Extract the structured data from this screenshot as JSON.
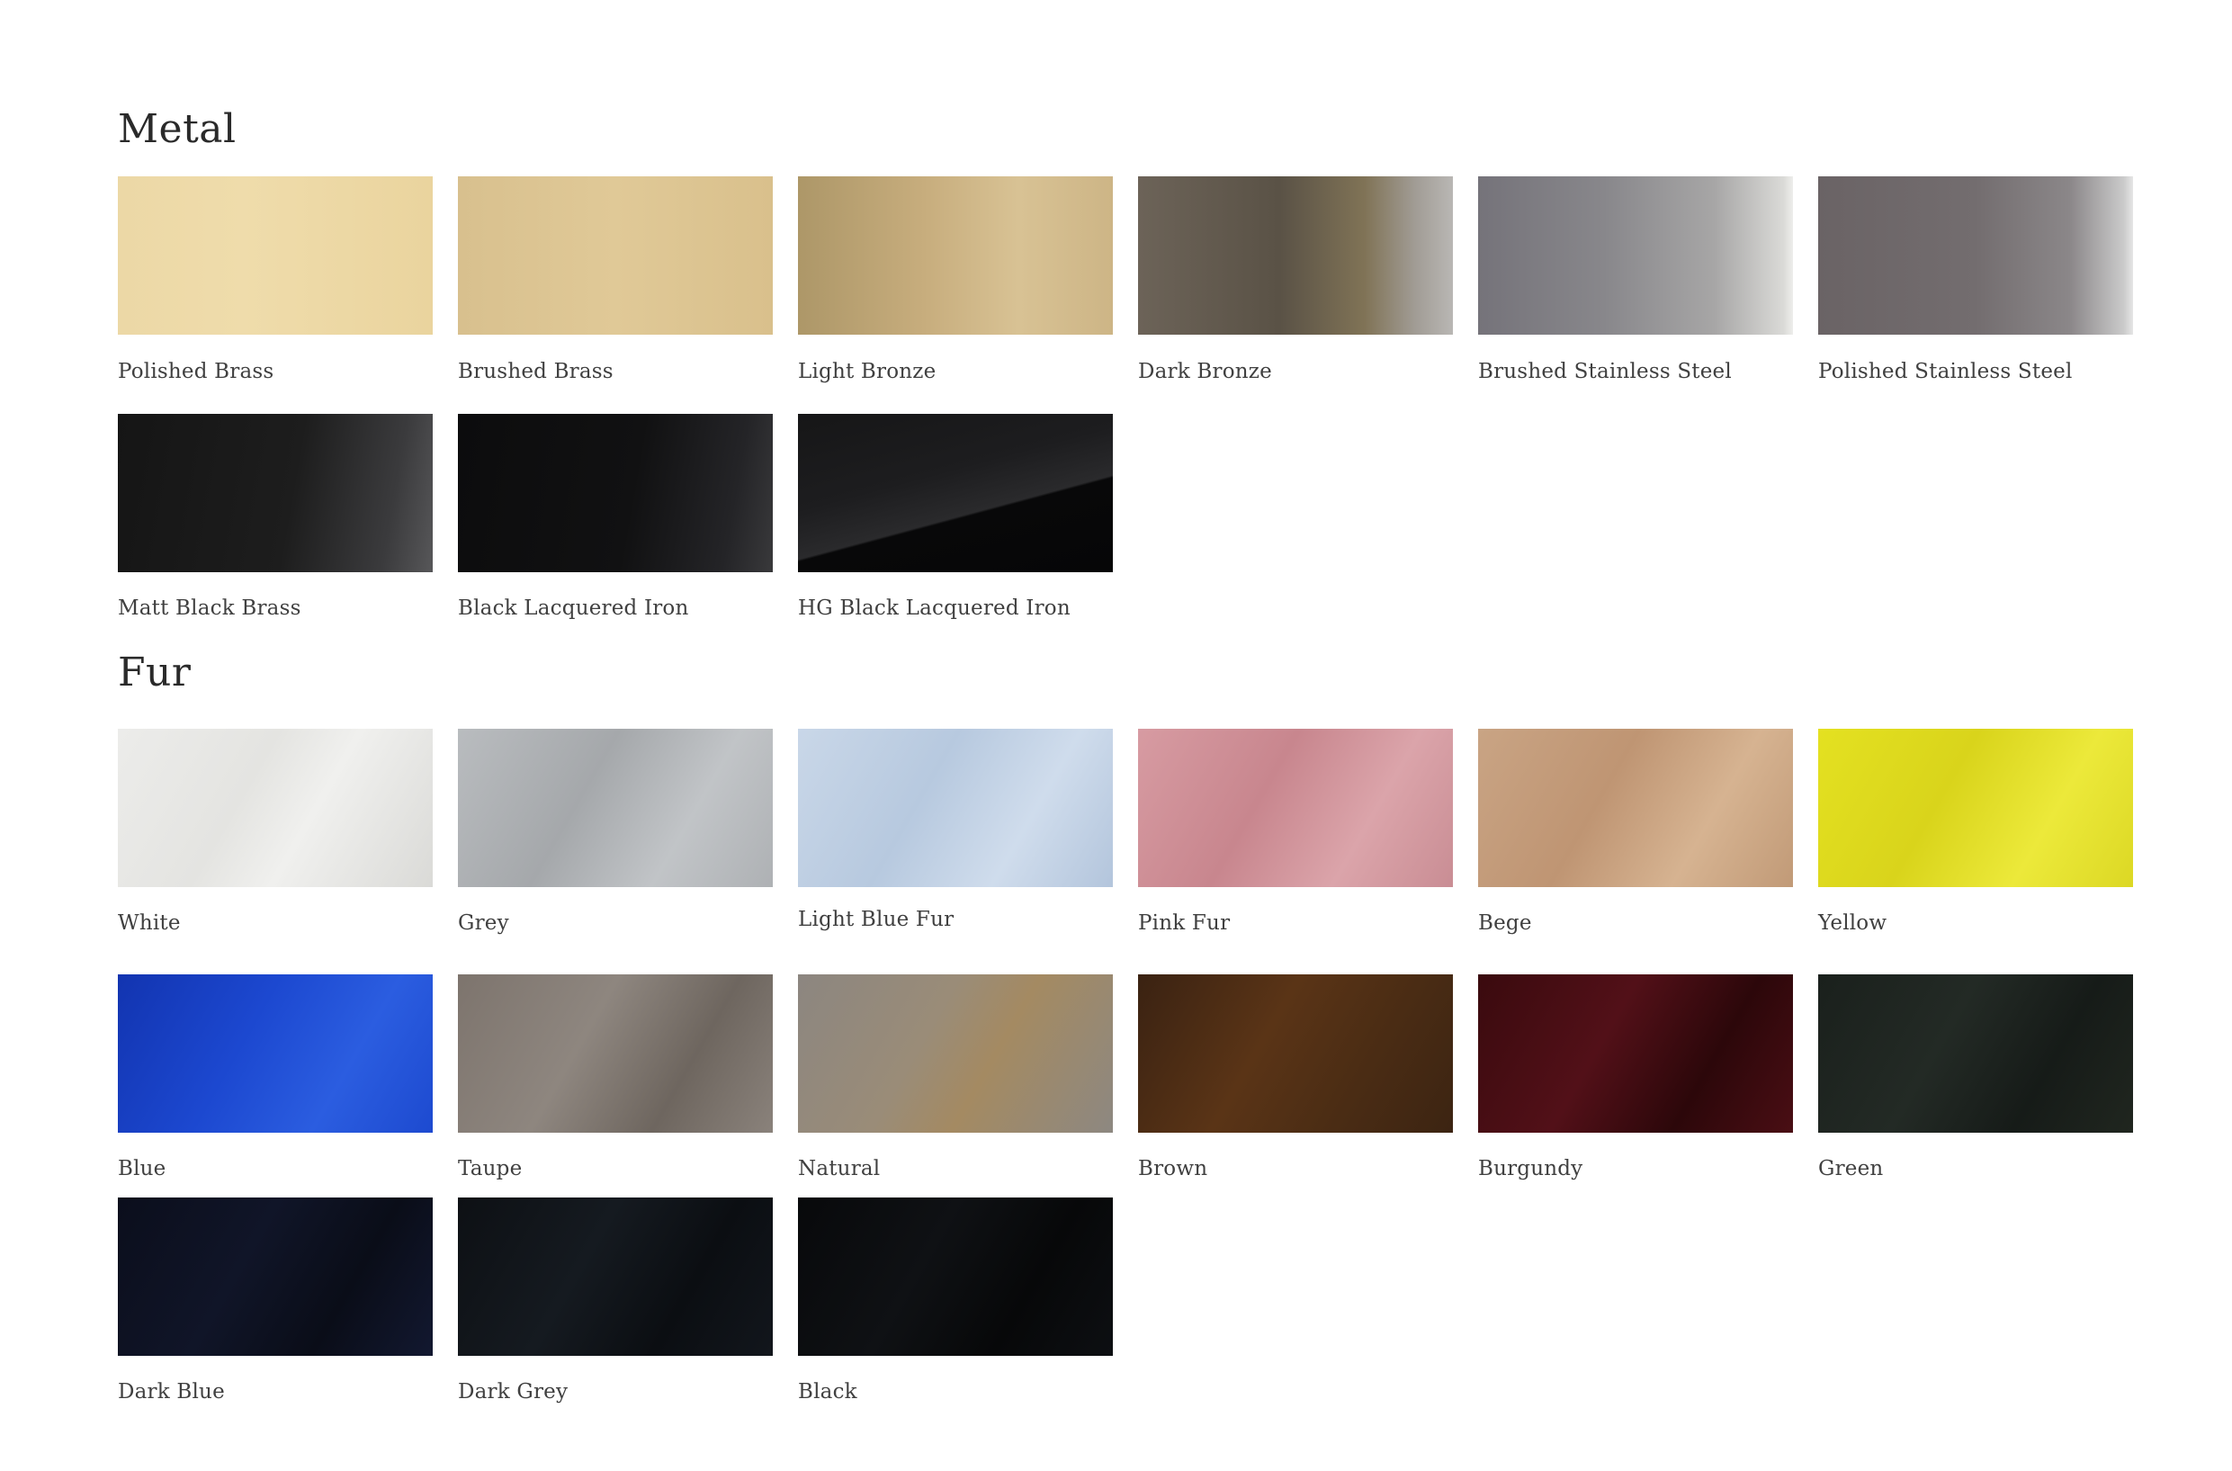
{
  "sections": [
    {
      "title": "Metal",
      "items": [
        {
          "label": "Polished Brass",
          "swatch": "linear-gradient(90deg,#ecd8a6 0%,#efdcab 40%,#ead49e 100%)"
        },
        {
          "label": "Brushed Brass",
          "swatch": "linear-gradient(90deg,#d8c08e 0%,#e0c997 50%,#d9c08c 100%)"
        },
        {
          "label": "Light Bronze",
          "swatch": "linear-gradient(90deg,#ad9768 0%,#c7ad7d 40%,#d8c294 70%,#cdb586 100%)"
        },
        {
          "label": "Dark Bronze",
          "swatch": "linear-gradient(90deg,#6c6358 0%,#5a5246 45%,#807356 72%,#a19c95 88%,#b9b7b4 100%)"
        },
        {
          "label": "Brushed Stainless Steel",
          "swatch": "linear-gradient(90deg,#75737a 0%,#88878b 40%,#a7a6a6 75%,#dadad7 97%,#eeeeec 100%)"
        },
        {
          "label": "Polished Stainless Steel",
          "swatch": "linear-gradient(90deg,#6a6365 0%,#736d6f 50%,#8b8789 80%,#cacaca 97%,#e6e6e6 100%)"
        }
      ]
    },
    {
      "title": "",
      "items": [
        {
          "label": "Matt Black Brass",
          "swatch": "linear-gradient(100deg,#151515 0%,#1d1d1d 55%,#3b3b3d 85%,#575759 100%)"
        },
        {
          "label": "Black Lacquered Iron",
          "swatch": "linear-gradient(100deg,#0c0c0d 0%,#111112 55%,#242427 85%,#39393b 100%)"
        },
        {
          "label": "HG Black Lacquered Iron",
          "swatch": "linear-gradient(165deg,#161617 0%,#1d1d1f 40%,#2a2a2c 60%,#080809 61%,#060607 100%)"
        }
      ]
    },
    {
      "title": "Fur",
      "items": [
        {
          "label": "White",
          "swatch": "linear-gradient(120deg,#ececea 0%,#e4e4e1 40%,#f0f0ee 60%,#dadad7 100%)"
        },
        {
          "label": "Grey",
          "swatch": "linear-gradient(120deg,#b9bcbf 0%,#a5a8ab 40%,#c1c4c7 70%,#aeb1b4 100%)"
        },
        {
          "label": "Light Blue Fur",
          "swatch": "linear-gradient(120deg,#c9d7e8 0%,#b7c9df 40%,#cfdcec 70%,#b3c5dc 100%)"
        },
        {
          "label": "Pink Fur",
          "swatch": "linear-gradient(120deg,#d79ba2 0%,#c8868e 40%,#dba4aa 70%,#c98d94 100%)"
        },
        {
          "label": "Bege",
          "swatch": "linear-gradient(120deg,#c9a484 0%,#bf9573 40%,#d6b391 70%,#c19a77 100%)"
        },
        {
          "label": "Yellow",
          "swatch": "linear-gradient(120deg,#e4e121 0%,#d9d41b 40%,#ece93a 70%,#dcd824 100%)"
        }
      ]
    },
    {
      "title": "",
      "items": [
        {
          "label": "Blue",
          "swatch": "linear-gradient(120deg,#1234b0 0%,#1c48d0 40%,#2b5de0 70%,#1d4ad0 100%)"
        },
        {
          "label": "Taupe",
          "swatch": "linear-gradient(120deg,#7d746d 0%,#8e867f 40%,#6e665f 70%,#8a827b 100%)"
        },
        {
          "label": "Natural",
          "swatch": "linear-gradient(120deg,#8c8680 0%,#9a8c78 40%,#a48a62 60%,#8d8881 100%)"
        },
        {
          "label": "Brown",
          "swatch": "linear-gradient(120deg,#3a2212 0%,#5a3416 40%,#4a2c14 70%,#3c2412 100%)"
        },
        {
          "label": "Burgundy",
          "swatch": "linear-gradient(120deg,#3a0a0e 0%,#521018 40%,#2c070a 70%,#4a0e14 100%)"
        },
        {
          "label": "Green",
          "swatch": "linear-gradient(120deg,#1a201c 0%,#232a25 40%,#161b18 70%,#20261f 100%)"
        }
      ]
    },
    {
      "title": "",
      "items": [
        {
          "label": "Dark Blue",
          "swatch": "linear-gradient(120deg,#0b0e1c 0%,#101528 40%,#0a0d18 70%,#121830 100%)"
        },
        {
          "label": "Dark Grey",
          "swatch": "linear-gradient(120deg,#0d1014 0%,#151a20 40%,#0b0e12 70%,#12161c 100%)"
        },
        {
          "label": "Black",
          "swatch": "linear-gradient(120deg,#08090b 0%,#0f1114 40%,#070809 70%,#0d0f12 100%)"
        }
      ]
    }
  ]
}
